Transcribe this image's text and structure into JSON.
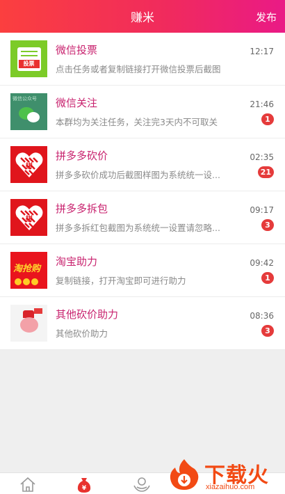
{
  "header": {
    "title": "赚米",
    "publish_label": "发布"
  },
  "tasks": [
    {
      "name": "微信投票",
      "desc": "点击任务或者复制链接打开微信投票后截图",
      "time": "12:17",
      "badge": "",
      "thumb_text": "投票"
    },
    {
      "name": "微信关注",
      "desc": "本群均为关注任务，关注完3天内不可取关",
      "time": "21:46",
      "badge": "1",
      "thumb_text": "微信公众号"
    },
    {
      "name": "拼多多砍价",
      "desc": "拼多多砍价成功后截图样图为系统统一设...",
      "time": "02:35",
      "badge": "21",
      "thumb_text": "拼"
    },
    {
      "name": "拼多多拆包",
      "desc": "拼多多拆红包截图为系统统一设置请忽略...",
      "time": "09:17",
      "badge": "3",
      "thumb_text": "拼"
    },
    {
      "name": "淘宝助力",
      "desc": "复制链接，打开淘宝即可进行助力",
      "time": "09:42",
      "badge": "1",
      "thumb_text": "淘抢购"
    },
    {
      "name": "其他砍价助力",
      "desc": "其他砍价助力",
      "time": "08:36",
      "badge": "3",
      "thumb_text": ""
    }
  ],
  "tabbar": {
    "icons": [
      "home-icon",
      "money-bag-icon",
      "hands-icon"
    ]
  },
  "watermark": {
    "cn": "下载火",
    "en": "xiazaihuo.com"
  },
  "colors": {
    "header_start": "#fb3f3f",
    "header_end": "#ea1a86",
    "task_title": "#c8226e",
    "badge": "#e53b3b",
    "active_tab": "#e8322e"
  }
}
